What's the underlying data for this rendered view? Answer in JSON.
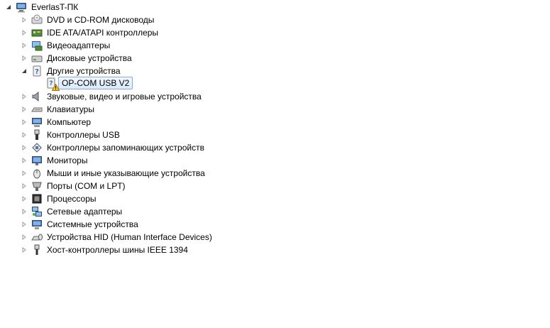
{
  "root": {
    "label": "EverlasT-ПК",
    "icon": "computer-root-icon"
  },
  "categories": [
    {
      "label": "DVD и CD-ROM дисководы",
      "icon": "dvd-drive-icon"
    },
    {
      "label": "IDE ATA/ATAPI контроллеры",
      "icon": "ide-controller-icon"
    },
    {
      "label": "Видеоадаптеры",
      "icon": "display-adapter-icon"
    },
    {
      "label": "Дисковые устройства",
      "icon": "disk-drive-icon"
    },
    {
      "label": "Другие устройства",
      "icon": "unknown-device-icon",
      "expanded": true
    },
    {
      "label": "Звуковые, видео и игровые устройства",
      "icon": "speaker-icon"
    },
    {
      "label": "Клавиатуры",
      "icon": "keyboard-icon"
    },
    {
      "label": "Компьютер",
      "icon": "computer-icon"
    },
    {
      "label": "Контроллеры USB",
      "icon": "usb-icon"
    },
    {
      "label": "Контроллеры запоминающих устройств",
      "icon": "storage-controller-icon"
    },
    {
      "label": "Мониторы",
      "icon": "monitor-icon"
    },
    {
      "label": "Мыши и иные указывающие устройства",
      "icon": "mouse-icon"
    },
    {
      "label": "Порты (COM и LPT)",
      "icon": "port-icon"
    },
    {
      "label": "Процессоры",
      "icon": "processor-icon"
    },
    {
      "label": "Сетевые адаптеры",
      "icon": "network-adapter-icon"
    },
    {
      "label": "Системные устройства",
      "icon": "system-device-icon"
    },
    {
      "label": "Устройства HID (Human Interface Devices)",
      "icon": "hid-device-icon"
    },
    {
      "label": "Хост-контроллеры шины IEEE 1394",
      "icon": "ieee1394-icon"
    }
  ],
  "child_device": {
    "label": "OP-COM USB V2",
    "icon": "warning-device-icon",
    "status": "warning"
  }
}
